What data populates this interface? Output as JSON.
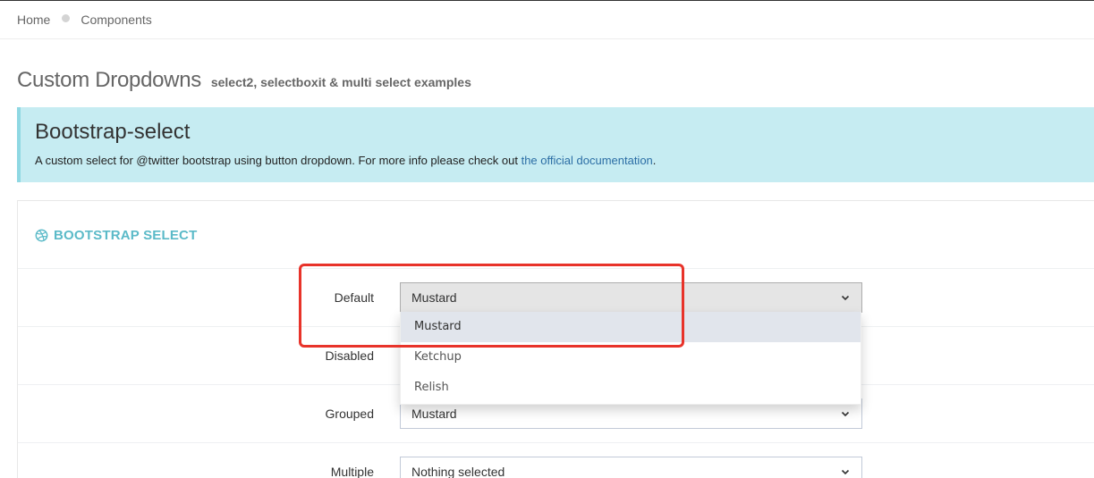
{
  "breadcrumb": {
    "home": "Home",
    "current": "Components"
  },
  "page": {
    "title": "Custom Dropdowns",
    "subtitle": "select2, selectboxit & multi select examples"
  },
  "note": {
    "title": "Bootstrap-select",
    "text": "A custom select for @twitter bootstrap using button dropdown. For more info please check out ",
    "link": "the official documentation",
    "text_end": "."
  },
  "portlet": {
    "title": "BOOTSTRAP SELECT",
    "icon": "dribbble-icon"
  },
  "form": {
    "rows": [
      {
        "label": "Default",
        "value": "Mustard"
      },
      {
        "label": "Disabled",
        "value": ""
      },
      {
        "label": "Grouped",
        "value": "Mustard"
      },
      {
        "label": "Multiple",
        "value": "Nothing selected"
      }
    ]
  },
  "dropdown": {
    "options": [
      "Mustard",
      "Ketchup",
      "Relish"
    ],
    "selected": "Mustard"
  },
  "colors": {
    "accent": "#5bbac8",
    "note_bg": "#c6ecf2",
    "highlight": "#e8332a",
    "link": "#2c6ea5"
  }
}
